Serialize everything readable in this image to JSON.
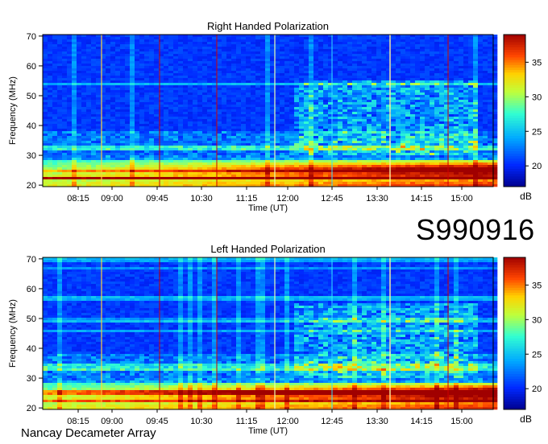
{
  "chart_data": [
    {
      "type": "heatmap",
      "title": "Right Handed Polarization",
      "xlabel": "Time (UT)",
      "ylabel": "Frequency (MHz)",
      "x_tick_labels": [
        "08:15",
        "09:00",
        "09:45",
        "10:30",
        "11:15",
        "12:00",
        "12:45",
        "13:30",
        "14:15",
        "15:00"
      ],
      "y_ticks": [
        20,
        30,
        40,
        50,
        60,
        70
      ],
      "ylim": [
        19.5,
        70.5
      ],
      "colorbar": {
        "label": "dB",
        "ticks": [
          20,
          25,
          30,
          35
        ],
        "range": [
          17,
          39
        ]
      },
      "colormap": [
        "#00008f",
        "#0030ff",
        "#00b0ff",
        "#30ffd0",
        "#c0ff40",
        "#ffd000",
        "#ff4000",
        "#a00000"
      ],
      "description_levels": {
        "low_freq_band_mhz": [
          20,
          30
        ],
        "high_intensity_mhz": [
          22,
          28
        ],
        "high_intensity_db": 38,
        "background_db": 18
      },
      "grid": false,
      "legend": "colorbar-right"
    },
    {
      "type": "heatmap",
      "title": "Left Handed Polarization",
      "xlabel": "Time (UT)",
      "ylabel": "Frequency (MHz)",
      "x_tick_labels": [
        "08:15",
        "09:00",
        "09:45",
        "10:30",
        "11:15",
        "12:00",
        "12:45",
        "13:30",
        "14:15",
        "15:00"
      ],
      "y_ticks": [
        20,
        30,
        40,
        50,
        60,
        70
      ],
      "ylim": [
        19.5,
        70.5
      ],
      "colorbar": {
        "label": "dB",
        "ticks": [
          20,
          25,
          30,
          35
        ],
        "range": [
          17,
          39
        ]
      },
      "colormap": [
        "#00008f",
        "#0030ff",
        "#00b0ff",
        "#30ffd0",
        "#c0ff40",
        "#ffd000",
        "#ff4000",
        "#a00000"
      ],
      "description_levels": {
        "low_freq_band_mhz": [
          20,
          30
        ],
        "high_intensity_mhz": [
          22,
          28
        ],
        "high_intensity_db": 38,
        "background_db": 18
      },
      "grid": false,
      "legend": "colorbar-right"
    }
  ],
  "labels": {
    "date_code": "S990916",
    "instrument": "Nancay Decameter Array"
  }
}
